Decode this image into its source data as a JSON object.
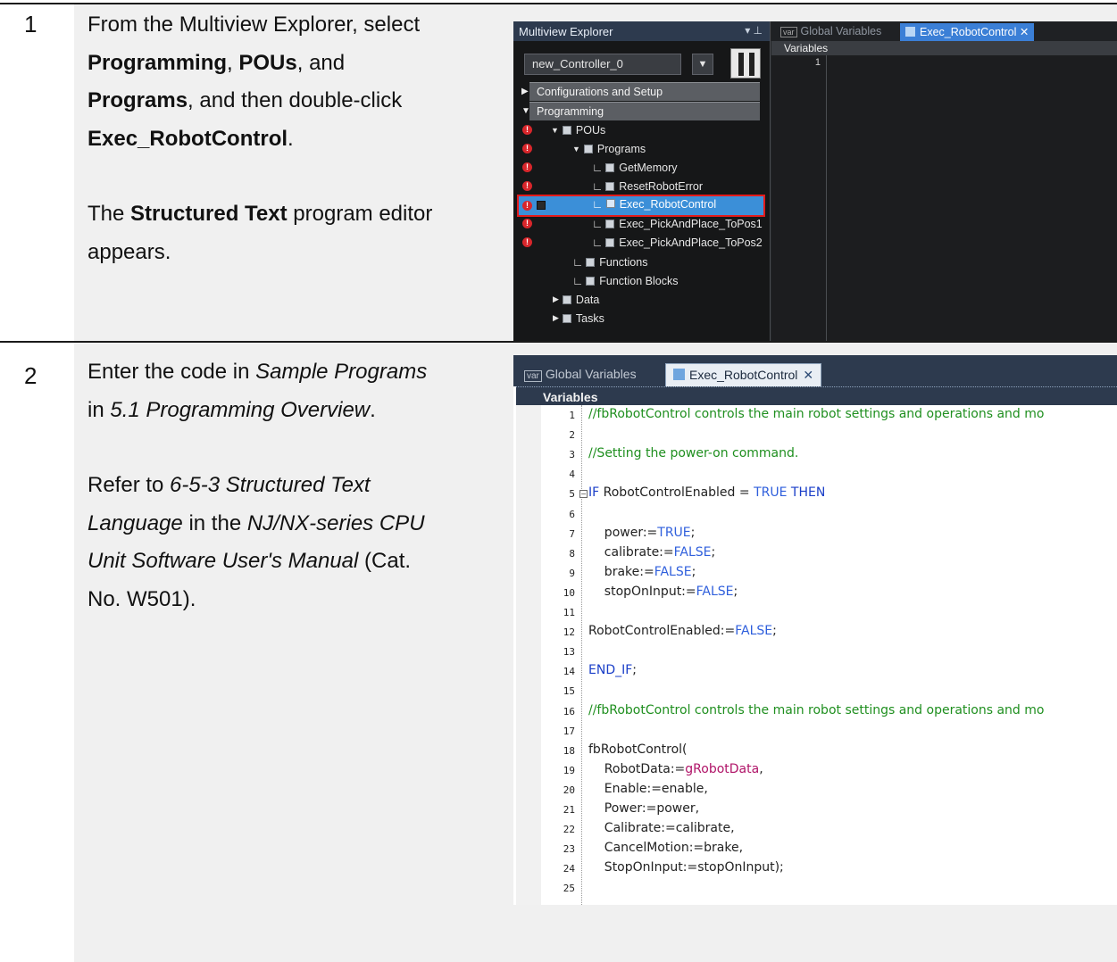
{
  "steps": [
    {
      "number": "1",
      "text": {
        "l1": "From the Multiview Explorer, select",
        "l2_b1": "Programming",
        "l2_sep1": ", ",
        "l2_b2": "POUs",
        "l2_sep2": ", and",
        "l3_b1": "Programs",
        "l3_tail": ", and then double-click",
        "l4_b1": "Exec_RobotControl",
        "l4_tail": ".",
        "l5_pre": "The ",
        "l5_b1": "Structured Text",
        "l5_tail": " program editor",
        "l6": "appears."
      }
    },
    {
      "number": "2",
      "text": {
        "l1_pre": "Enter the code in ",
        "l1_i": "Sample Programs",
        "l2_pre": "in ",
        "l2_i": "5.1 Programming Overview",
        "l2_tail": ".",
        "l3_pre": "Refer to ",
        "l3_i": "6-5-3 Structured Text",
        "l4_i1": "Language",
        "l4_mid": " in the ",
        "l4_i2": "NJ/NX-series CPU",
        "l5_i": "Unit Software User's Manual",
        "l5_tail": " (Cat.",
        "l6": "No. W501)."
      }
    }
  ],
  "screenshot1": {
    "explorer_title": "Multiview Explorer",
    "pin_glyphs": "▾ ⊥",
    "controller": "new_Controller_0",
    "sections": {
      "config": "Configurations and Setup",
      "programming": "Programming"
    },
    "tree": {
      "pous": "POUs",
      "programs": "Programs",
      "items": [
        "GetMemory",
        "ResetRobotError",
        "Exec_RobotControl",
        "Exec_PickAndPlace_ToPos1",
        "Exec_PickAndPlace_ToPos2"
      ],
      "functions": "Functions",
      "function_blocks": "Function Blocks",
      "data": "Data",
      "tasks": "Tasks"
    },
    "tabs": {
      "badge": "var",
      "global": "Global Variables",
      "active": "Exec_RobotControl ✕"
    },
    "variables_label": "Variables",
    "editor_line": "1"
  },
  "screenshot2": {
    "tabs": {
      "badge": "var",
      "global": "Global Variables",
      "active": "Exec_RobotControl",
      "close": "✕"
    },
    "variables_label": "Variables",
    "code": [
      "//fbRobotControl controls the main robot settings and operations and mo",
      "",
      "//Setting the power-on command.",
      "",
      "IF RobotControlEnabled = TRUE THEN",
      "",
      "    power:=TRUE;",
      "    calibrate:=FALSE;",
      "    brake:=FALSE;",
      "    stopOnInput:=FALSE;",
      "",
      "RobotControlEnabled:=FALSE;",
      "",
      "END_IF;",
      "",
      "//fbRobotControl controls the main robot settings and operations and mo",
      "",
      "fbRobotControl(",
      "    RobotData:=gRobotData,",
      "    Enable:=enable,",
      "    Power:=power,",
      "    Calibrate:=calibrate,",
      "    CancelMotion:=brake,",
      "    StopOnInput:=stopOnInput);",
      ""
    ],
    "line_numbers": [
      "1",
      "2",
      "3",
      "4",
      "5",
      "6",
      "7",
      "8",
      "9",
      "10",
      "11",
      "12",
      "13",
      "14",
      "15",
      "16",
      "17",
      "18",
      "19",
      "20",
      "21",
      "22",
      "23",
      "24",
      "25"
    ]
  }
}
